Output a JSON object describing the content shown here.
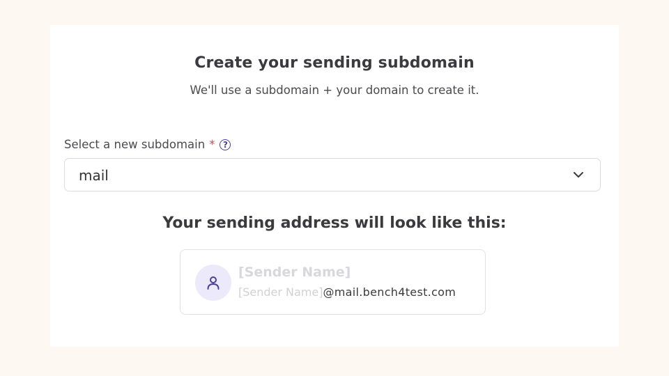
{
  "header": {
    "title": "Create your sending subdomain",
    "subtitle": "We'll use a subdomain + your domain to create it."
  },
  "subdomain_field": {
    "label": "Select a new subdomain",
    "required_marker": "*",
    "help_icon": "question-circle-icon",
    "help_glyph": "?",
    "selected_value": "mail",
    "dropdown_icon": "chevron-down-icon"
  },
  "preview": {
    "heading": "Your sending address will look like this:",
    "avatar_icon": "user-icon",
    "sender_name_placeholder": "[Sender Name]",
    "address_name_placeholder": "[Sender Name]",
    "address_domain": "@mail.bench4test.com"
  },
  "colors": {
    "page_background": "#fdf8f2",
    "accent": "#4a3f9b",
    "required": "#d14b4b",
    "avatar_background": "#ece9fb"
  }
}
